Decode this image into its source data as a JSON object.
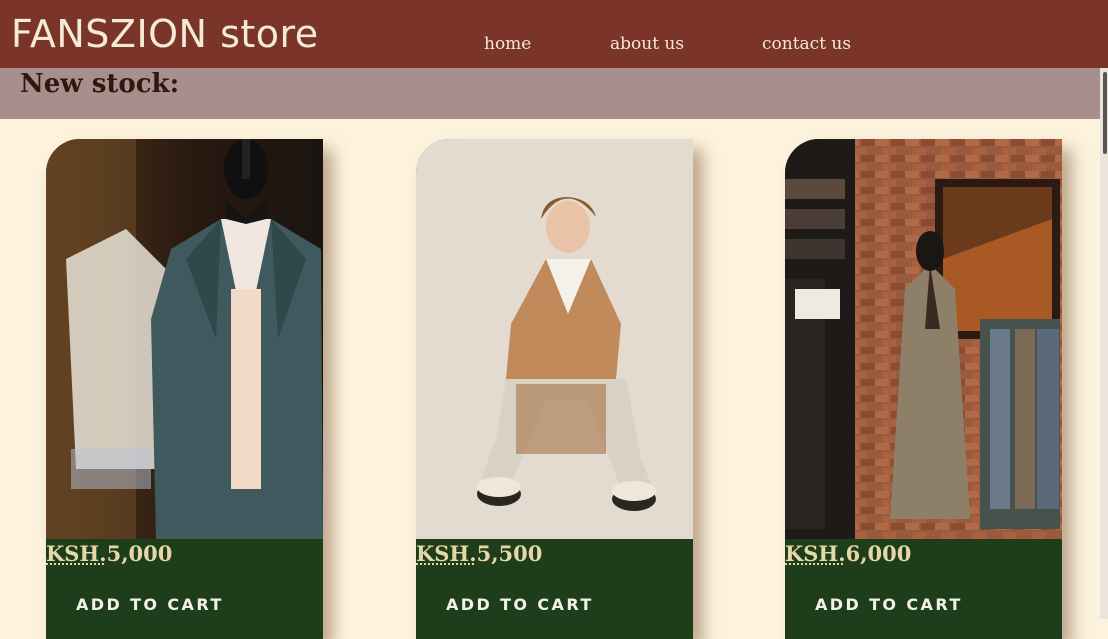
{
  "header": {
    "brand": "FANSZION store",
    "nav": [
      {
        "label": "home"
      },
      {
        "label": "about us"
      },
      {
        "label": "contact us"
      }
    ]
  },
  "section": {
    "title": "New stock:"
  },
  "products": [
    {
      "currency": "KSH.",
      "price": "5,000",
      "cart_label": "ADD TO CART",
      "image": "navy-check-suit-on-mannequin"
    },
    {
      "currency": "KSH.",
      "price": "5,500",
      "cart_label": "ADD TO CART",
      "image": "man-in-camel-blazer-seated"
    },
    {
      "currency": "KSH.",
      "price": "6,000",
      "cart_label": "ADD TO CART",
      "image": "plaid-suit-in-boutique"
    }
  ],
  "colors": {
    "header_bg": "#7a3428",
    "subheader_bg": "#a68f8c",
    "page_bg": "#fdf3dd",
    "card_bg": "#1e3e1b"
  }
}
